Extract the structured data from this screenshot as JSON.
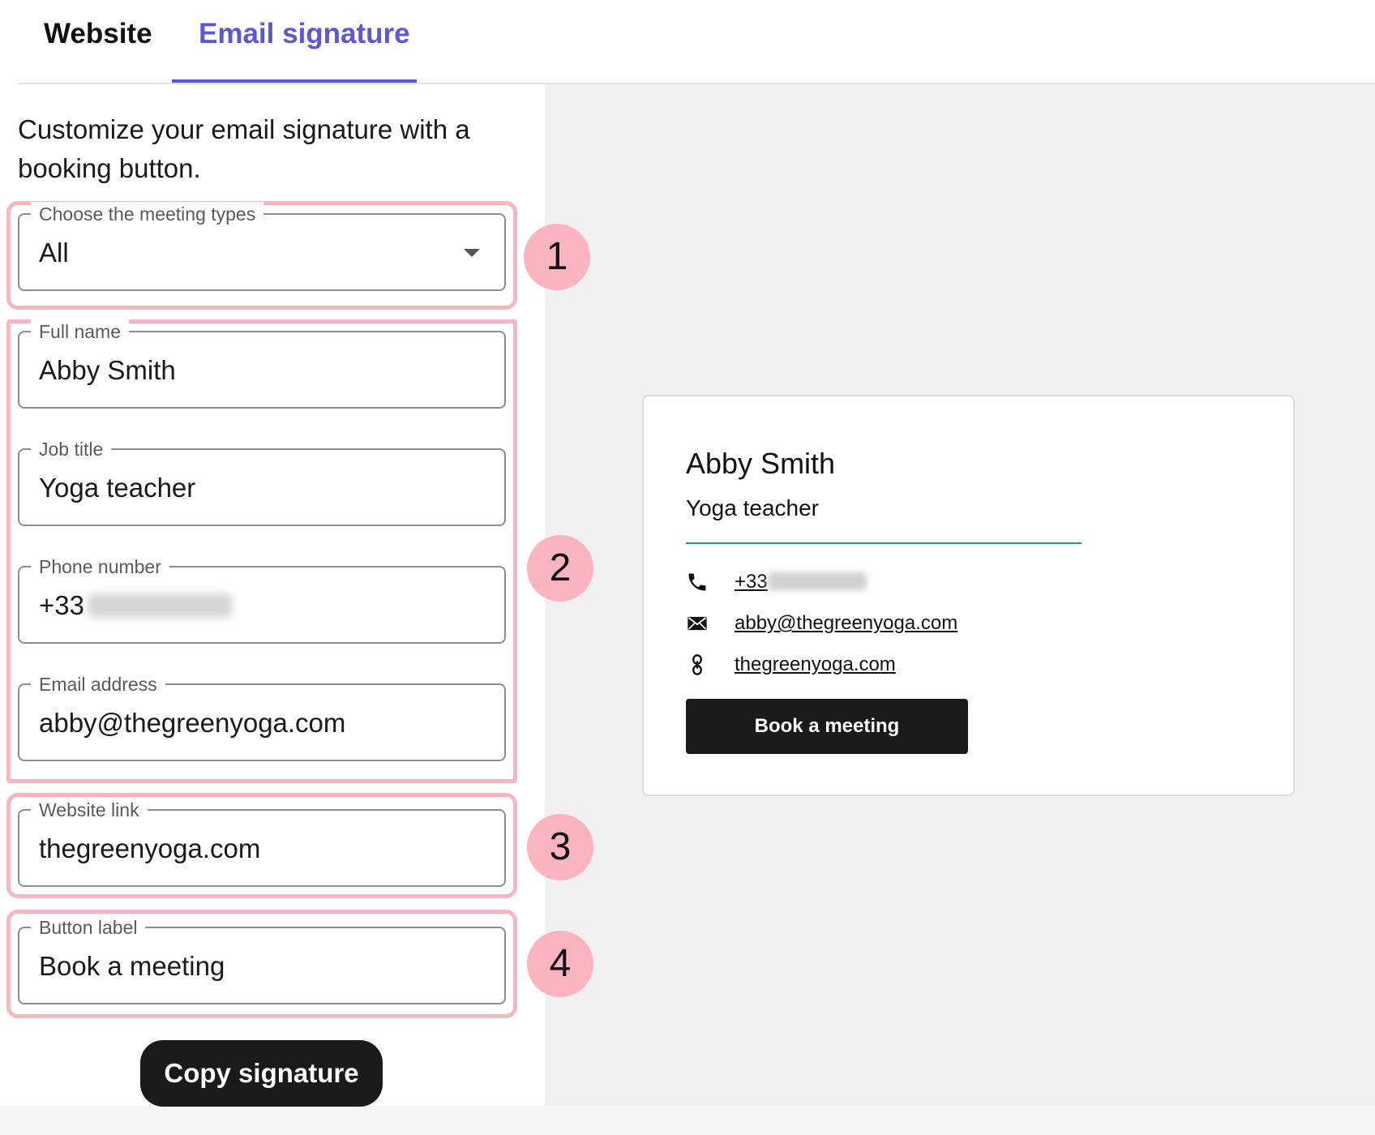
{
  "tabs": [
    {
      "label": "Website"
    },
    {
      "label": "Email signature"
    }
  ],
  "intro_text": "Customize your email signature with a booking button.",
  "form": {
    "meeting_types": {
      "label": "Choose the meeting types",
      "value": "All"
    },
    "full_name": {
      "label": "Full name",
      "value": "Abby Smith"
    },
    "job_title": {
      "label": "Job title",
      "value": "Yoga teacher"
    },
    "phone": {
      "label": "Phone number",
      "value": "+33"
    },
    "email": {
      "label": "Email address",
      "value": "abby@thegreenyoga.com"
    },
    "website": {
      "label": "Website link",
      "value": "thegreenyoga.com"
    },
    "button_label": {
      "label": "Button label",
      "value": "Book a meeting"
    }
  },
  "badges": [
    "1",
    "2",
    "3",
    "4"
  ],
  "copy_button": "Copy signature",
  "signature": {
    "name": "Abby Smith",
    "title": "Yoga teacher",
    "phone": "+33",
    "email": "abby@thegreenyoga.com",
    "website": "thegreenyoga.com",
    "button": "Book a meeting",
    "divider_color": "#2a9d6a"
  },
  "colors": {
    "accent": "#5b57d6",
    "highlight": "#f7b7c1",
    "badge": "#fcb4c0"
  }
}
